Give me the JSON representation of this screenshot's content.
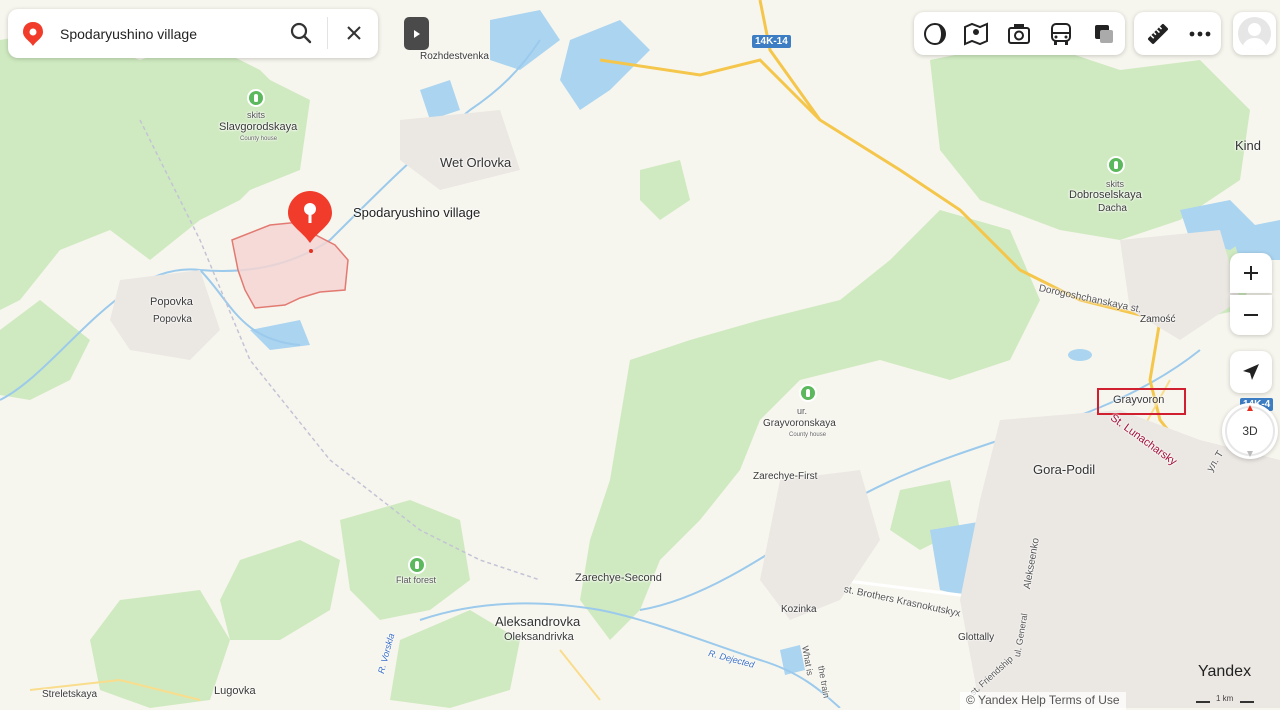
{
  "search": {
    "value": "Spodaryushino village"
  },
  "map": {
    "places": {
      "rozhdestvenka": "Rozhdestvenka",
      "slavgorodskaya_small": "skits",
      "slavgorodskaya": "Slavgorodskaya",
      "slavgorodskaya_micro": "County house",
      "wet_orlovka": "Wet Orlovka",
      "spodaryushino": "Spodaryushino village",
      "popovka": "Popovka",
      "popovka2": "Popovka",
      "kind": "Kind",
      "dobroselskaya_small": "skits",
      "dobroselskaya": "Dobroselskaya",
      "dobroselskaya2": "Dacha",
      "dorogoshchanskaya": "Dorogoshchanskaya st.",
      "zamosc": "Zamość",
      "grayvoron": "Grayvoron",
      "lunacharsky": "St. Lunacharsky",
      "ul_t": "ул. Т",
      "grayvoronskaya_small": "ur.",
      "grayvoronskaya": "Grayvoronskaya",
      "grayvoronskaya_micro": "County house",
      "zarechye_first": "Zarechye-First",
      "gora_podil": "Gora-Podil",
      "flat_forest": "Flat forest",
      "zarechye_second": "Zarechye-Second",
      "brothers": "st. Brothers Krasnokutskyx",
      "alekseenko": "Alekseenko",
      "kozinka": "Kozinka",
      "aleksandrovka": "Aleksandrovka",
      "oleksandrivka": "Oleksandrivka",
      "r_dejected": "R. Dejected",
      "glottally": "Glottally",
      "ul_general": "ul. General",
      "friendship": "st. Friendship",
      "what_is": "What is",
      "the_train": "the train",
      "r_vorskla": "R. Vorskla",
      "streletskaya": "Streletskaya",
      "lugovka": "Lugovka"
    },
    "road_14k14": "14K-14",
    "road_14k4": "14K-4"
  },
  "toolbar": {
    "icons": [
      "layers-icon",
      "panorama-icon",
      "photo-icon",
      "transit-icon",
      "traffic-icon",
      "ruler-icon",
      "more-icon",
      "avatar"
    ]
  },
  "controls": {
    "three_d": "3D"
  },
  "footer": {
    "copyright": "© Yandex Help Terms of Use",
    "brand": "Yandex",
    "scale": "1 km"
  },
  "colors": {
    "forest": "#cfeac0",
    "water": "#aad4f0",
    "pin": "#f13c2c",
    "road_major": "#f5c64c",
    "highlight_box": "#d01f2f"
  }
}
